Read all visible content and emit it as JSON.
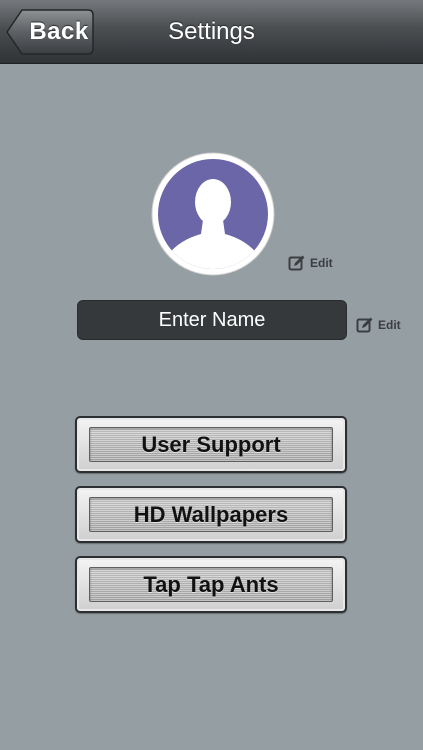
{
  "navbar": {
    "back_label": "Back",
    "title": "Settings"
  },
  "profile": {
    "avatar_icon": "default-user-silhouette-icon",
    "avatar_color": "#6a66a8",
    "edit_photo_label": "Edit",
    "name_placeholder": "Enter Name",
    "edit_name_label": "Edit"
  },
  "menu": {
    "items": [
      {
        "label": "User Support"
      },
      {
        "label": "HD Wallpapers"
      },
      {
        "label": "Tap Tap Ants"
      }
    ]
  },
  "colors": {
    "background": "#959ea2",
    "navbar": "#4a4e51",
    "name_field": "#35393b"
  }
}
